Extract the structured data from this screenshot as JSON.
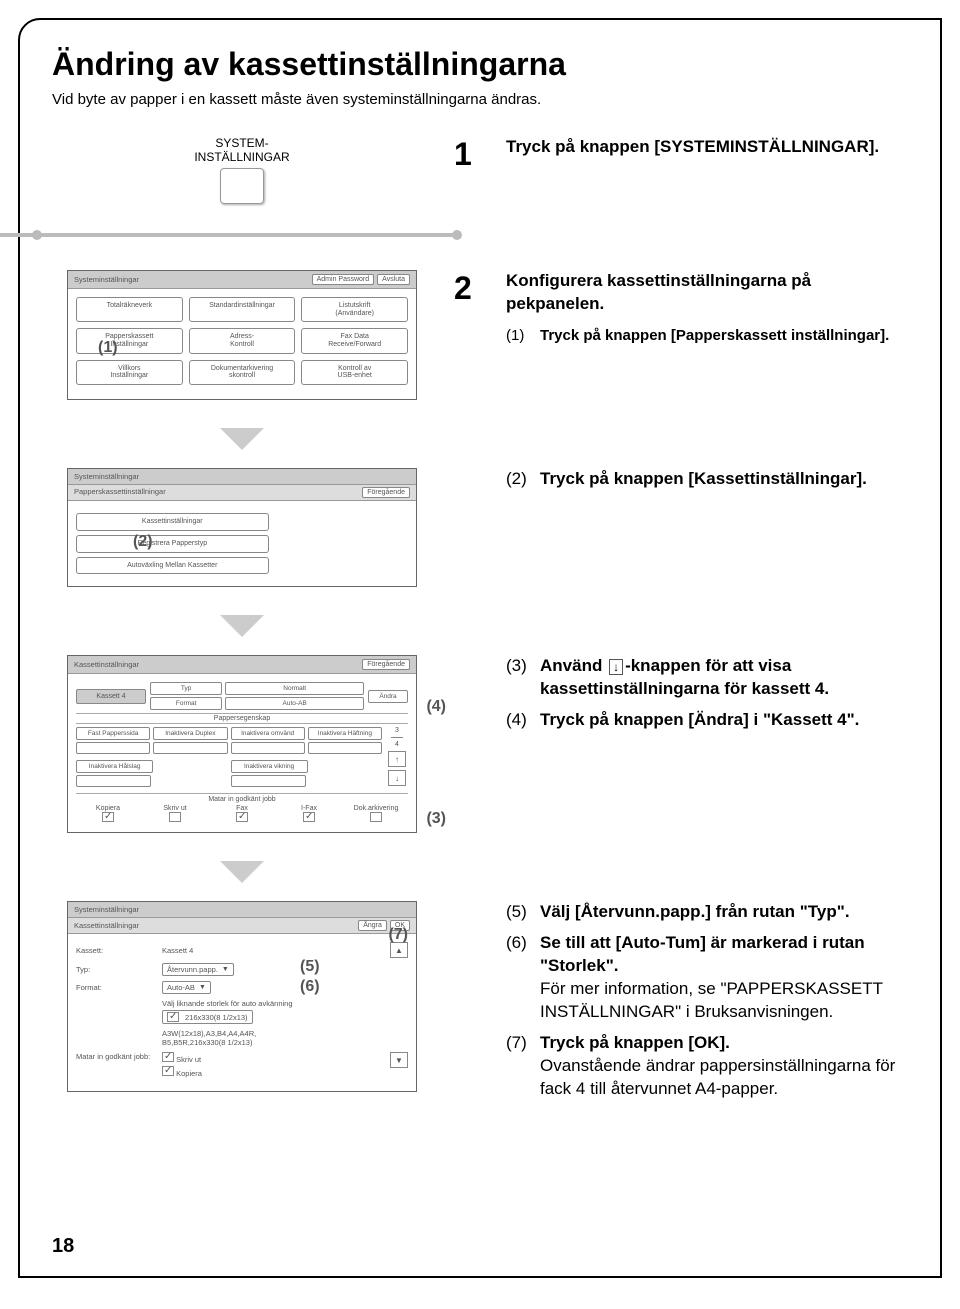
{
  "title": "Ändring av kassettinställningarna",
  "subtitle": "Vid byte av papper i en kassett måste även systeminställningarna ändras.",
  "page_number": "18",
  "hw_key_label": "SYSTEM-\nINSTÄLLNINGAR",
  "arrow_icon_glyph": "↓",
  "steps": {
    "s1": {
      "num": "1",
      "text": "Tryck på knappen [SYSTEMINSTÄLLNINGAR]."
    },
    "s2": {
      "num": "2",
      "text": "Konfigurera kassettinställningarna på pekpanelen.",
      "subs": {
        "a": {
          "n": "(1)",
          "t": "Tryck på knappen [Papperskassett inställningar]."
        },
        "b": {
          "n": "(2)",
          "t": "Tryck på knappen [Kassettinställningar]."
        },
        "c_pre": "Använd ",
        "c_post": "-knappen för att visa kassettinställningarna för kassett 4.",
        "c_n": "(3)",
        "d": {
          "n": "(4)",
          "t": "Tryck på knappen [Ändra] i \"Kassett 4\"."
        },
        "e": {
          "n": "(5)",
          "t": "Välj [Återvunn.papp.] från rutan \"Typ\"."
        },
        "f": {
          "n": "(6)",
          "t": "Se till att [Auto-Tum] är markerad i rutan \"Storlek\"."
        },
        "f_extra": "För mer information, se \"PAPPERSKASSETT INSTÄLLNINGAR\" i Bruksanvisningen.",
        "g": {
          "n": "(7)",
          "t": "Tryck på knappen [OK]."
        },
        "g_extra": "Ovanstående ändrar pappersinställningarna för fack 4 till återvunnet A4-papper."
      }
    }
  },
  "panel1": {
    "title": "Systeminställningar",
    "admin": "Admin Password",
    "close": "Avsluta",
    "buttons": {
      "r1": [
        "Totalräkneverk",
        "Standardinställningar",
        "Listutskrift\n(Användare)"
      ],
      "r2": [
        "Papperskassett\nInställningar",
        "Adress-\nKontroll",
        "Fax Data\nReceive/Forward"
      ],
      "r3": [
        "Villkors\nInställningar",
        "Dokumentarkivering\nskontroll",
        "Kontroll av\nUSB-enhet"
      ]
    },
    "callout": "(1)"
  },
  "panel2": {
    "title": "Systeminställningar",
    "header": "Papperskassettinställningar",
    "prev": "Föregående",
    "items": [
      "Kassettinställningar",
      "Registrera Papperstyp",
      "Autoväxling Mellan Kassetter"
    ],
    "callout": "(2)"
  },
  "panel3": {
    "title": "Kassettinställningar",
    "prev": "Föregående",
    "kassett": "Kassett 4",
    "typ_label": "Typ",
    "typ_val": "Normalt",
    "fmt_label": "Format",
    "fmt_val": "Auto-AB",
    "andra": "Ändra",
    "egenskap": "Pappersegenskap",
    "cols": [
      "Fast Papperssida",
      "Inaktivera Duplex",
      "Inaktivera omvänd",
      "Inaktivera Häftning"
    ],
    "cols2": [
      "Inaktivera Hålslag",
      "",
      "Inaktivera vikning",
      ""
    ],
    "nums": [
      "3",
      "4"
    ],
    "footer_title": "Matar in godkänt jobb",
    "footer": [
      "Kopiera",
      "Skriv ut",
      "Fax",
      "I-Fax",
      "Dok.arkivering"
    ],
    "callout_up": "(4)",
    "callout_dn": "(3)"
  },
  "panel4": {
    "title": "Systeminställningar",
    "header": "Kassettinställningar",
    "cancel": "Ångra",
    "ok": "OK",
    "kassett_label": "Kassett:",
    "kassett_val": "Kassett 4",
    "typ_label": "Typ:",
    "typ_val": "Återvunn.papp.",
    "fmt_label": "Format:",
    "fmt_val": "Auto-AB",
    "auto_hint": "Välj liknande storlek för auto avkänning",
    "auto_size": "216x330(8 1/2x13)",
    "sizes_line": "A3W(12x18),A3,B4,A4,A4R,\nB5,B5R,216x330(8 1/2x13)",
    "jobs_label": "Matar in godkänt jobb:",
    "jobs": [
      "Skriv ut",
      "Kopiera"
    ],
    "callout5": "(5)",
    "callout6": "(6)",
    "callout7": "(7)"
  }
}
